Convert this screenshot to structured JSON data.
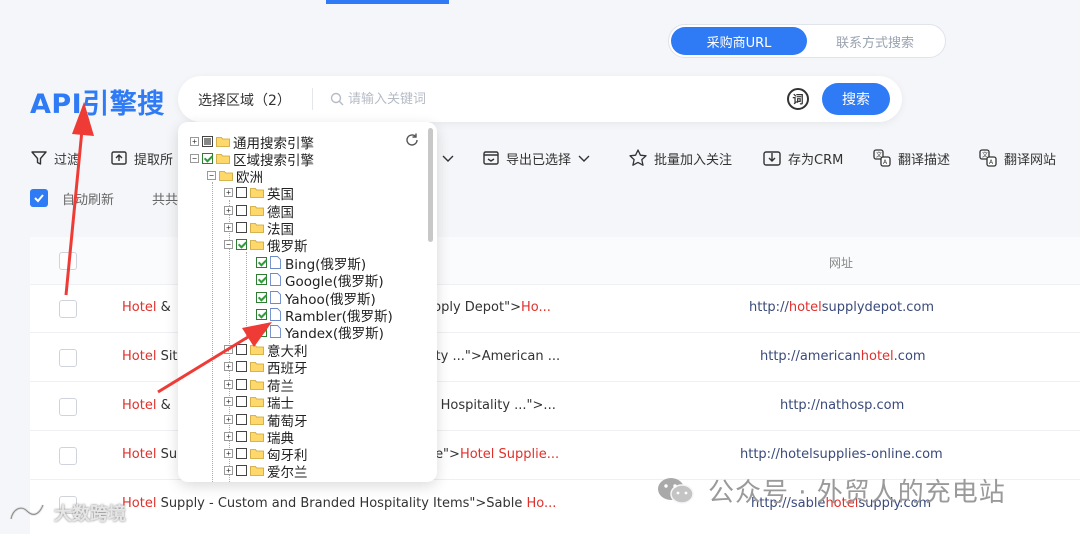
{
  "header": {
    "tabs": [
      {
        "label": "采购商URL",
        "active": true
      },
      {
        "label": "联系方式搜索",
        "active": false
      }
    ]
  },
  "logo": "API引擎搜",
  "search": {
    "region_label": "选择区域（2）",
    "placeholder": "请输入关键词",
    "dict_label": "词",
    "button": "搜索"
  },
  "toolbar": {
    "filter": "过滤",
    "extract": "提取所",
    "export_selected": "导出已选择",
    "batch_follow": "批量加入关注",
    "save_crm": "存为CRM",
    "translate_desc": "翻译描述",
    "translate_site": "翻译网站"
  },
  "subrow": {
    "auto_refresh": "自动刷新",
    "total": "共共"
  },
  "table": {
    "url_header": "网址",
    "rows": [
      {
        "t1": "Hotel",
        "t2": " & ",
        "t3": "pply Depot\">",
        "t4": "Ho...",
        "u1": "http://",
        "u2": "hotel",
        "u3": "supplydepot.com"
      },
      {
        "t1": "Hotel",
        "t2": " Sit",
        "t3": "ty ...\">American ...",
        "t4": "",
        "u1": "http://american",
        "u2": "hotel",
        "u3": ".com"
      },
      {
        "t1": "Hotel",
        "t2": " & ",
        "t3": "l Hospitality ...\">...",
        "t4": "",
        "u1": "http://nathosp.com",
        "u2": "",
        "u3": ""
      },
      {
        "t1": "Hotel",
        "t2": " Su",
        "t3": "e\">",
        "t4": "Hotel Supplie...",
        "u1": "http://hotelsupplies-online.com",
        "u2": "",
        "u3": ""
      },
      {
        "t1": "Hotel",
        "t2": " Supply - Custom and Branded Hospitality Items\">Sable ",
        "t3": "Ho...",
        "t4": "",
        "u1": "http://sable",
        "u2": "hotel",
        "u3": "supply.com"
      }
    ]
  },
  "tree": {
    "general": "通用搜索引擎",
    "regional": "区域搜索引擎",
    "europe": "欧洲",
    "countries_top": [
      "英国",
      "德国",
      "法国"
    ],
    "russia": "俄罗斯",
    "russia_engines": [
      "Bing(俄罗斯)",
      "Google(俄罗斯)",
      "Yahoo(俄罗斯)",
      "Rambler(俄罗斯)",
      "Yandex(俄罗斯)"
    ],
    "countries_bottom": [
      "意大利",
      "西班牙",
      "荷兰",
      "瑞士",
      "葡萄牙",
      "瑞典",
      "匈牙利",
      "爱尔兰"
    ]
  },
  "watermarks": {
    "wechat": "公众号 · 外贸人的充电站",
    "brand": "大数跨境"
  },
  "colors": {
    "accent": "#2f7bf5",
    "highlight": "#e0302b",
    "arrow": "#ef3b36"
  }
}
